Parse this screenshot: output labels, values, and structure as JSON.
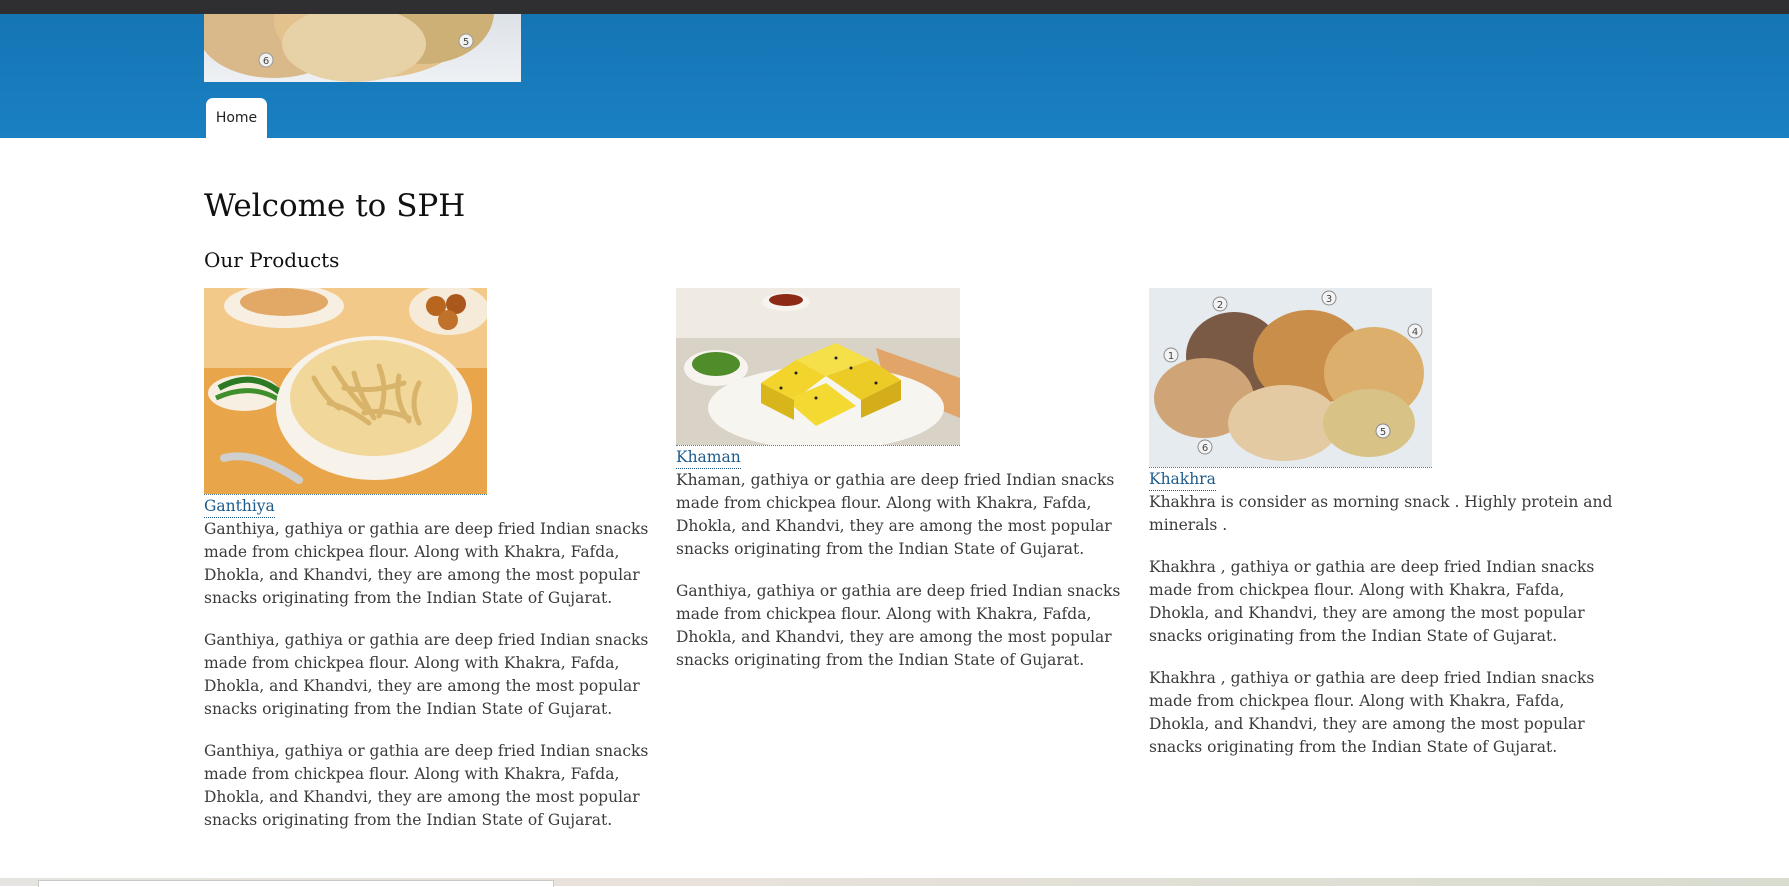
{
  "nav": {
    "home_label": "Home"
  },
  "page": {
    "title": "Welcome to SPH",
    "subtitle": "Our Products"
  },
  "products": [
    {
      "name": "Ganthiya",
      "paragraphs": [
        "Ganthiya, gathiya or gathia are deep fried Indian snacks made from chickpea flour. Along with Khakra, Fafda, Dhokla, and Khandvi, they are among the most popular snacks originating from the Indian State of Gujarat.",
        "Ganthiya, gathiya or gathia are deep fried Indian snacks made from chickpea flour. Along with Khakra, Fafda, Dhokla, and Khandvi, they are among the most popular snacks originating from the Indian State of Gujarat.",
        "Ganthiya, gathiya or gathia are deep fried Indian snacks made from chickpea flour. Along with Khakra, Fafda, Dhokla, and Khandvi, they are among the most popular snacks originating from the Indian State of Gujarat."
      ]
    },
    {
      "name": "Khaman",
      "paragraphs": [
        "Khaman, gathiya or gathia are deep fried Indian snacks made from chickpea flour. Along with Khakra, Fafda, Dhokla, and Khandvi, they are among the most popular snacks originating from the Indian State of Gujarat.",
        "Ganthiya, gathiya or gathia are deep fried Indian snacks made from chickpea flour. Along with Khakra, Fafda, Dhokla, and Khandvi, they are among the most popular snacks originating from the Indian State of Gujarat."
      ]
    },
    {
      "name": "Khakhra",
      "paragraphs": [
        "Khakhra is consider as morning snack . Highly protein and minerals .",
        "Khakhra , gathiya or gathia are deep fried Indian snacks made from chickpea flour. Along with Khakra, Fafda, Dhokla, and Khandvi, they are among the most popular snacks originating from the Indian State of Gujarat.",
        "Khakhra , gathiya or gathia are deep fried Indian snacks made from chickpea flour. Along with Khakra, Fafda, Dhokla, and Khandvi, they are among the most popular snacks originating from the Indian State of Gujarat."
      ]
    }
  ],
  "image_numbers": {
    "banner": [
      "6",
      "5"
    ],
    "khakhra": [
      "1",
      "2",
      "3",
      "4",
      "5",
      "6"
    ]
  },
  "colors": {
    "header_blue": "#1a7dbf",
    "link_blue": "#1d5b8c",
    "topbar": "#2f2f31"
  }
}
